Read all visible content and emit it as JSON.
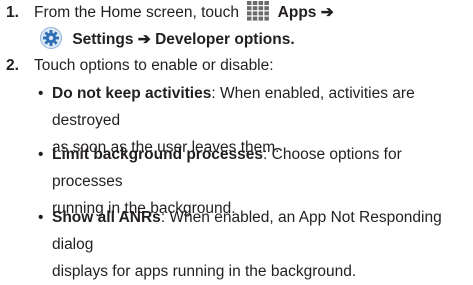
{
  "steps": [
    {
      "number": "1.",
      "line1_prefix": "From the Home screen, touch",
      "apps_icon": "apps-grid-icon",
      "apps_label": "Apps",
      "arrow1": "➔",
      "settings_icon": "settings-gear-icon",
      "settings_label": "Settings",
      "arrow2": "➔",
      "developer_label": "Developer options",
      "period": "."
    },
    {
      "number": "2.",
      "text": "Touch options to enable or disable:"
    }
  ],
  "bullets": [
    {
      "marker": "•",
      "term": "Do not keep activities",
      "line1": ": When enabled, activities are destroyed",
      "line2": "as soon as the user leaves them."
    },
    {
      "marker": "•",
      "term": "Limit background processes",
      "line1": ": Choose options for processes",
      "line2": "running in the background."
    },
    {
      "marker": "•",
      "term": "Show all ANRs",
      "line1": ": When enabled, an App Not Responding dialog",
      "line2": "displays for apps running in the background."
    }
  ],
  "colors": {
    "text": "#231f20",
    "apps_icon": "#6b6b6b",
    "settings_gear": "#2f6fb5",
    "settings_ring": "#8fb3dc"
  }
}
